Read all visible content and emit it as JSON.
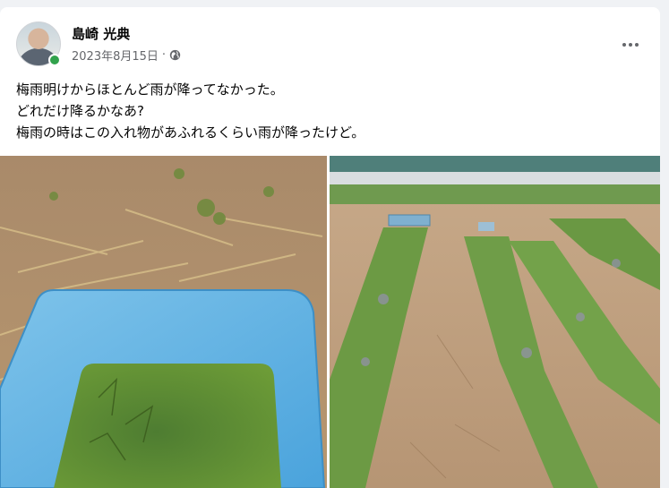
{
  "post": {
    "author_name": "島崎 光典",
    "date": "2023年8月15日",
    "separator": "·",
    "privacy_icon": "globe-icon",
    "more_icon": "more-options-icon",
    "text_lines": [
      "梅雨明けからほとんど雨が降ってなかった。",
      "どれだけ降るかなあ?",
      "梅雨の時はこの入れ物があふれるくらい雨が降ったけど。"
    ]
  },
  "photos": [
    {
      "icon": "photo-container-with-water"
    },
    {
      "icon": "photo-herb-garden-rows"
    }
  ],
  "colors": {
    "online": "#31a24c",
    "secondary_text": "#65676b",
    "background": "#f0f2f5"
  }
}
